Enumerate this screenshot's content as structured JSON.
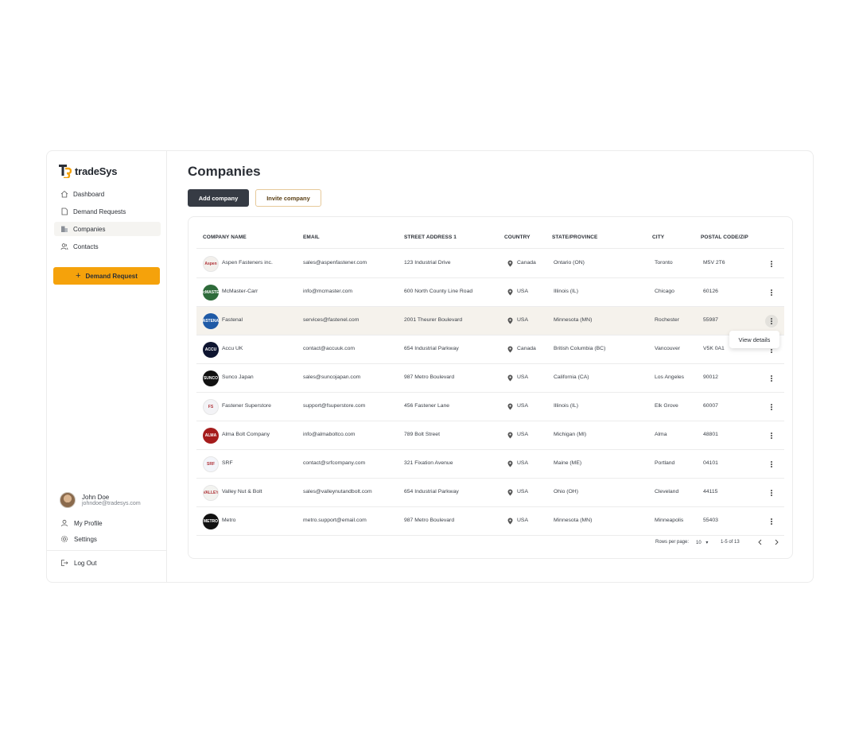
{
  "brand": {
    "name": "tradeSys",
    "accent": "#f5a20b"
  },
  "nav": [
    {
      "label": "Dashboard",
      "icon": "home-icon"
    },
    {
      "label": "Demand Requests",
      "icon": "document-icon"
    },
    {
      "label": "Companies",
      "icon": "building-icon",
      "active": true
    },
    {
      "label": "Contacts",
      "icon": "users-icon"
    }
  ],
  "demand_button": "Demand Request",
  "user": {
    "name": "John Doe",
    "email": "johndoe@tradesys.com"
  },
  "side_links": {
    "profile": "My Profile",
    "settings": "Settings",
    "logout": "Log Out"
  },
  "page": {
    "title": "Companies",
    "add_label": "Add company",
    "invite_label": "Invite company"
  },
  "table": {
    "columns": [
      "COMPANY NAME",
      "EMAIL",
      "STREET ADDRESS 1",
      "COUNTRY",
      "STATE/PROVINCE",
      "CITY",
      "POSTAL CODE/ZIP"
    ],
    "rows": [
      {
        "name": "Aspen Fasteners inc.",
        "email": "sales@aspenfastener.com",
        "street": "123 Industrial Drive",
        "country": "Canada",
        "state": "Ontario (ON)",
        "city": "Toronto",
        "postal": "M5V 2T6",
        "logo_color": "#f3f0ec",
        "logo_text": "Aspen"
      },
      {
        "name": "McMaster-Carr",
        "email": "info@mcmaster.com",
        "street": "600 North County Line Road",
        "country": "USA",
        "state": "Illinois (IL)",
        "city": "Chicago",
        "postal": "60126",
        "logo_color": "#2e6b3a",
        "logo_text": "McMASTER"
      },
      {
        "name": "Fastenal",
        "email": "services@fastenel.com",
        "street": "2001 Theurer Boulevard",
        "country": "USA",
        "state": "Minnesota (MN)",
        "city": "Rochester",
        "postal": "55987",
        "logo_color": "#1f5aa6",
        "logo_text": "FASTENAL"
      },
      {
        "name": "Accu UK",
        "email": "contact@accuuk.com",
        "street": "654 Industrial Parkway",
        "country": "Canada",
        "state": "British Columbia (BC)",
        "city": "Vancouver",
        "postal": "V5K 0A1",
        "logo_color": "#0e1530",
        "logo_text": "ACCU"
      },
      {
        "name": "Sunco Japan",
        "email": "sales@suncojapan.com",
        "street": "987 Metro Boulevard",
        "country": "USA",
        "state": "California (CA)",
        "city": "Los Angeles",
        "postal": "90012",
        "logo_color": "#111111",
        "logo_text": "SUNCO"
      },
      {
        "name": "Fastener Superstore",
        "email": "support@fsuperstore.com",
        "street": "456 Fastener Lane",
        "country": "USA",
        "state": "Illinois (IL)",
        "city": "Elk Grove",
        "postal": "60007",
        "logo_color": "#f3f3f6",
        "logo_text": "FS"
      },
      {
        "name": "Alma Bolt Company",
        "email": "info@almaboltco.com",
        "street": "789 Bolt Street",
        "country": "USA",
        "state": "Michigan (MI)",
        "city": "Alma",
        "postal": "48801",
        "logo_color": "#a51c1c",
        "logo_text": "ALMA"
      },
      {
        "name": "SRF",
        "email": "contact@srfcompany.com",
        "street": "321 Fixation Avenue",
        "country": "USA",
        "state": "Maine (ME)",
        "city": "Portland",
        "postal": "04101",
        "logo_color": "#f3f5fa",
        "logo_text": "SRF"
      },
      {
        "name": "Valley Nut & Bolt",
        "email": "sales@valleynutandbolt.com",
        "street": "654 Industrial Parkway",
        "country": "USA",
        "state": "Ohio (OH)",
        "city": "Cleveland",
        "postal": "44115",
        "logo_color": "#f3f3f0",
        "logo_text": "VALLEY"
      },
      {
        "name": "Metro",
        "email": "metro.support@email.com",
        "street": "987 Metro Boulevard",
        "country": "USA",
        "state": "Minnesota (MN)",
        "city": "Minneapolis",
        "postal": "55403",
        "logo_color": "#111111",
        "logo_text": "METRO"
      }
    ]
  },
  "row_menu": {
    "label": "View details"
  },
  "pagination": {
    "rows_label": "Rows per page:",
    "rows_value": "10",
    "range": "1-5 of 13"
  }
}
